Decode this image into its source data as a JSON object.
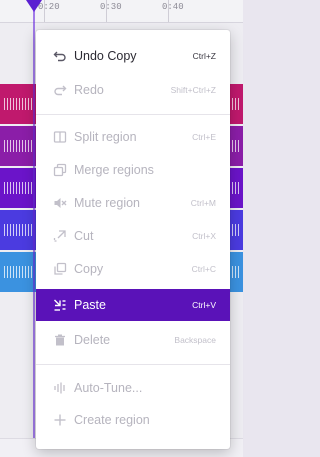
{
  "colors": {
    "accent": "#5a12b8",
    "track_colors": [
      "#c0196d",
      "#8b1ea8",
      "#6b14c9",
      "#4b3be0",
      "#3b92e0"
    ]
  },
  "timeline": {
    "ticks": [
      "0:20",
      "0:30",
      "0:40"
    ]
  },
  "menu": {
    "items": [
      {
        "label": "Undo Copy",
        "shortcut": "Ctrl+Z",
        "icon": "undo-icon",
        "state": "enabled"
      },
      {
        "label": "Redo",
        "shortcut": "Shift+Ctrl+Z",
        "icon": "redo-icon",
        "state": "disabled"
      },
      {
        "label": "Split region",
        "shortcut": "Ctrl+E",
        "icon": "split-icon",
        "state": "disabled"
      },
      {
        "label": "Merge regions",
        "shortcut": "",
        "icon": "merge-icon",
        "state": "disabled"
      },
      {
        "label": "Mute region",
        "shortcut": "Ctrl+M",
        "icon": "mute-icon",
        "state": "disabled"
      },
      {
        "label": "Cut",
        "shortcut": "Ctrl+X",
        "icon": "cut-icon",
        "state": "disabled"
      },
      {
        "label": "Copy",
        "shortcut": "Ctrl+C",
        "icon": "copy-icon",
        "state": "disabled"
      },
      {
        "label": "Paste",
        "shortcut": "Ctrl+V",
        "icon": "paste-icon",
        "state": "active"
      },
      {
        "label": "Delete",
        "shortcut": "Backspace",
        "icon": "trash-icon",
        "state": "disabled"
      },
      {
        "label": "Auto-Tune...",
        "shortcut": "",
        "icon": "autotune-icon",
        "state": "disabled"
      },
      {
        "label": "Create region",
        "shortcut": "",
        "icon": "plus-icon",
        "state": "disabled"
      }
    ]
  }
}
